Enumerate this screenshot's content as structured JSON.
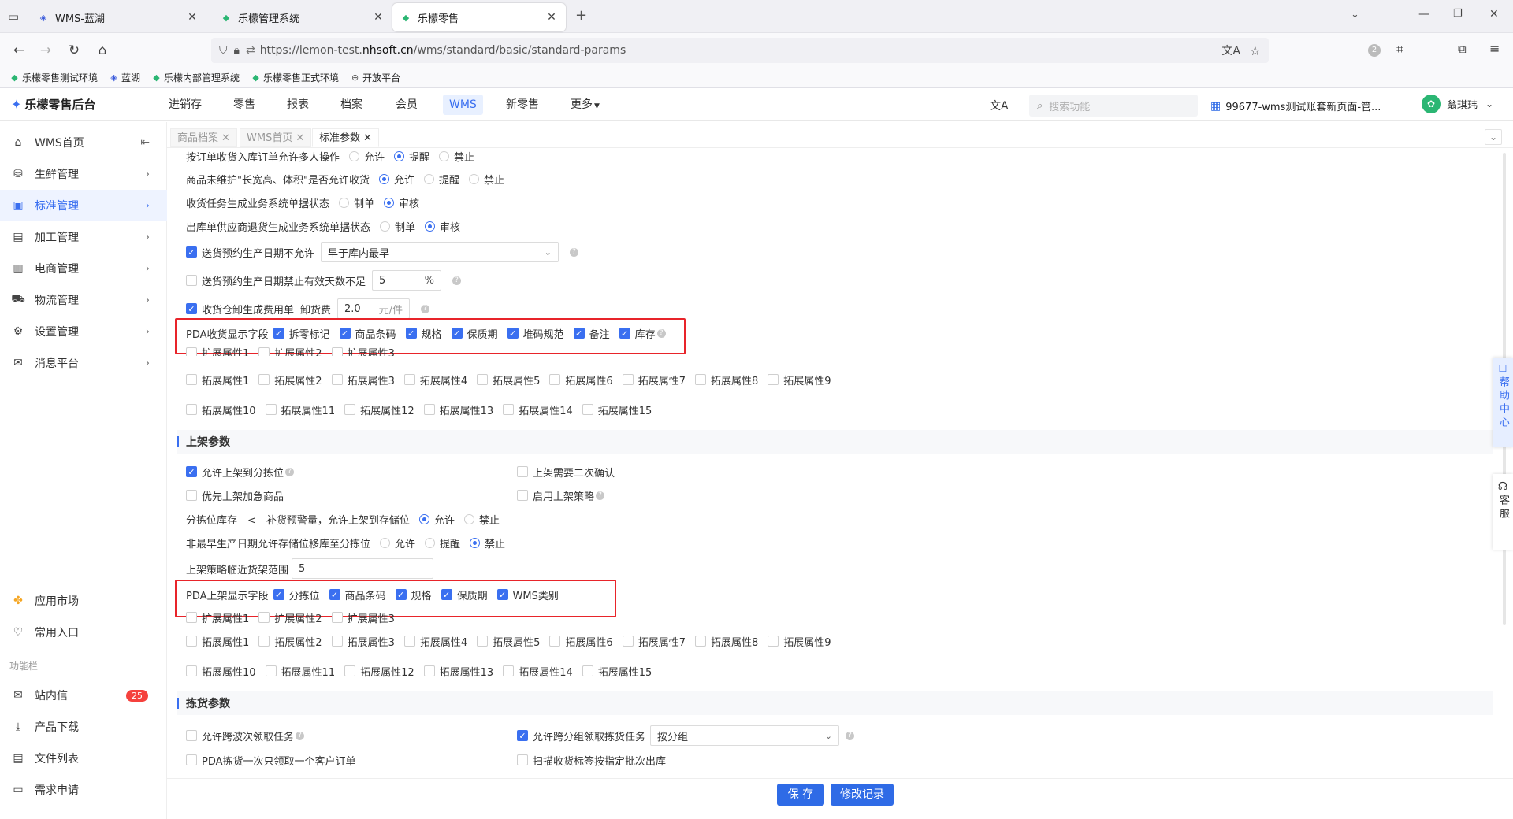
{
  "browser": {
    "tabs": [
      {
        "title": "WMS-蓝湖"
      },
      {
        "title": "乐檬管理系统"
      },
      {
        "title": "乐檬零售"
      }
    ],
    "url_prefix": "https://lemon-test.",
    "url_domain": "nhsoft.cn",
    "url_path": "/wms/standard/basic/standard-params",
    "ext_badge": "2",
    "bookmarks": [
      "乐檬零售测试环境",
      "蓝湖",
      "乐檬内部管理系统",
      "乐檬零售正式环境",
      "开放平台"
    ]
  },
  "app": {
    "logo": "乐檬零售后台",
    "menus": [
      "进销存",
      "零售",
      "报表",
      "档案",
      "会员",
      "WMS",
      "新零售",
      "更多"
    ],
    "active_menu": "WMS",
    "search_placeholder": "搜索功能",
    "account": "99677-wms测试账套新页面-管...",
    "user": "翁琪玮"
  },
  "sidebar": {
    "items": [
      {
        "label": "WMS首页",
        "icon": "home-icon"
      },
      {
        "label": "生鲜管理",
        "icon": "basket-icon"
      },
      {
        "label": "标准管理",
        "icon": "box-icon"
      },
      {
        "label": "加工管理",
        "icon": "factory-icon"
      },
      {
        "label": "电商管理",
        "icon": "store-icon"
      },
      {
        "label": "物流管理",
        "icon": "truck-icon"
      },
      {
        "label": "设置管理",
        "icon": "gear-icon"
      },
      {
        "label": "消息平台",
        "icon": "message-icon"
      }
    ],
    "bottom": [
      {
        "label": "应用市场"
      },
      {
        "label": "常用入口"
      }
    ],
    "section_label": "功能栏",
    "tools": [
      {
        "label": "站内信",
        "badge": "25"
      },
      {
        "label": "产品下载"
      },
      {
        "label": "文件列表"
      },
      {
        "label": "需求申请"
      }
    ]
  },
  "page_tabs": [
    "商品档案",
    "WMS首页",
    "标准参数"
  ],
  "receive": {
    "row1": {
      "label": "按订单收货入库订单允许多人操作",
      "options": [
        "允许",
        "提醒",
        "禁止"
      ],
      "selected": "提醒"
    },
    "row2": {
      "label": "商品未维护\"长宽高、体积\"是否允许收货",
      "options": [
        "允许",
        "提醒",
        "禁止"
      ],
      "selected": "允许"
    },
    "row3": {
      "label": "收货任务生成业务系统单据状态",
      "options": [
        "制单",
        "审核"
      ],
      "selected": "审核"
    },
    "row4": {
      "label": "出库单供应商退货生成业务系统单据状态",
      "options": [
        "制单",
        "审核"
      ],
      "selected": "审核"
    },
    "row5": {
      "label": "送货预约生产日期不允许",
      "select": "早于库内最早"
    },
    "row6": {
      "label": "送货预约生产日期禁止有效天数不足",
      "value": "5",
      "unit": "%"
    },
    "row7": {
      "label": "收货仓卸生成费用单",
      "fee_label": "卸货费",
      "value": "2.0",
      "unit": "元/件"
    },
    "pda_label": "PDA收货显示字段",
    "pda_fields": [
      "拆零标记",
      "商品条码",
      "规格",
      "保质期",
      "堆码规范",
      "备注",
      "库存"
    ],
    "pda_ext": [
      "扩展属性1",
      "扩展属性2",
      "扩展属性3"
    ],
    "ext_row1": [
      "拓展属性1",
      "拓展属性2",
      "拓展属性3",
      "拓展属性4",
      "拓展属性5",
      "拓展属性6",
      "拓展属性7",
      "拓展属性8",
      "拓展属性9"
    ],
    "ext_row2": [
      "拓展属性10",
      "拓展属性11",
      "拓展属性12",
      "拓展属性13",
      "拓展属性14",
      "拓展属性15"
    ]
  },
  "shelf": {
    "title": "上架参数",
    "c1": "允许上架到分拣位",
    "c2": "上架需要二次确认",
    "c3": "优先上架加急商品",
    "c4": "启用上架策略",
    "r1": {
      "label": "分拣位库存　<　补货预警量，允许上架到存储位",
      "options": [
        "允许",
        "禁止"
      ],
      "selected": "允许"
    },
    "r2": {
      "label": "非最早生产日期允许存储位移库至分拣位",
      "options": [
        "允许",
        "提醒",
        "禁止"
      ],
      "selected": "禁止"
    },
    "r3": {
      "label": "上架策略临近货架范围",
      "value": "5"
    },
    "pda_label": "PDA上架显示字段",
    "pda_fields": [
      "分拣位",
      "商品条码",
      "规格",
      "保质期",
      "WMS类别"
    ],
    "pda_ext": [
      "扩展属性1",
      "扩展属性2",
      "扩展属性3"
    ],
    "ext_row1": [
      "拓展属性1",
      "拓展属性2",
      "拓展属性3",
      "拓展属性4",
      "拓展属性5",
      "拓展属性6",
      "拓展属性7",
      "拓展属性8",
      "拓展属性9"
    ],
    "ext_row2": [
      "拓展属性10",
      "拓展属性11",
      "拓展属性12",
      "拓展属性13",
      "拓展属性14",
      "拓展属性15"
    ]
  },
  "pick": {
    "title": "拣货参数",
    "c1": "允许跨波次领取任务",
    "c2": "允许跨分组领取拣货任务",
    "c2_select": "按分组",
    "c3": "PDA拣货一次只领取一个客户订单",
    "c4": "扫描收货标签按指定批次出库"
  },
  "footer": {
    "save": "保 存",
    "history": "修改记录"
  },
  "float": {
    "help": "帮助中心",
    "service": "客服"
  },
  "colors": {
    "accent": "#3a6ff0",
    "highlight": "#e8242a",
    "button": "#2f6be6"
  }
}
